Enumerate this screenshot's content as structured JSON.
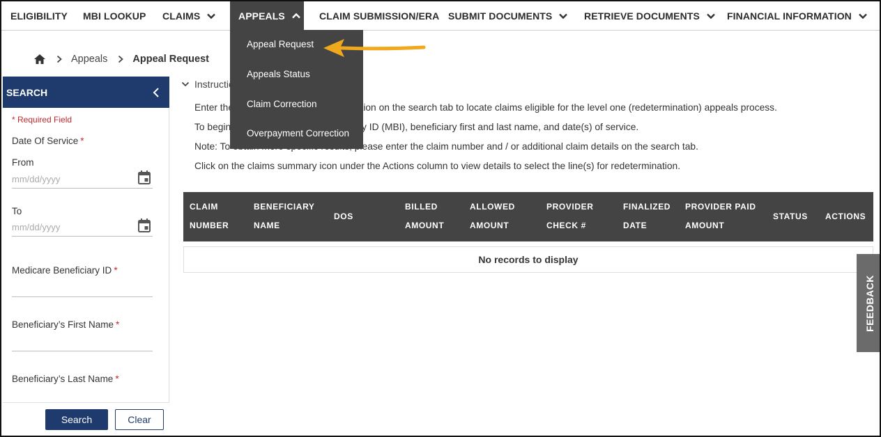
{
  "nav": {
    "items": [
      {
        "label": "ELIGIBILITY",
        "dropdown": false
      },
      {
        "label": "MBI LOOKUP",
        "dropdown": false
      },
      {
        "label": "CLAIMS",
        "dropdown": true
      },
      {
        "label": "APPEALS",
        "dropdown": true,
        "active": true
      },
      {
        "label": "CLAIM SUBMISSION/ERA",
        "dropdown": false
      },
      {
        "label": "SUBMIT DOCUMENTS",
        "dropdown": true
      },
      {
        "label": "RETRIEVE DOCUMENTS",
        "dropdown": true
      },
      {
        "label": "FINANCIAL INFORMATION",
        "dropdown": true
      }
    ],
    "appeals_menu": [
      "Appeal Request",
      "Appeals Status",
      "Claim Correction",
      "Overpayment Correction"
    ]
  },
  "breadcrumb": {
    "icon": "home-icon",
    "parent": "Appeals",
    "current": "Appeal Request"
  },
  "sidebar": {
    "title": "SEARCH",
    "required_note": "* Required Field",
    "date_of_service_label": "Date Of Service",
    "from_label": "From",
    "from_placeholder": "mm/dd/yyyy",
    "to_label": "To",
    "to_placeholder": "mm/dd/yyyy",
    "mbi_label": "Medicare Beneficiary ID",
    "first_name_label": "Beneficiary’s First Name",
    "last_name_label": "Beneficiary’s Last Name",
    "required_marker": "*",
    "search_button": "Search",
    "clear_button": "Clear"
  },
  "instructions": {
    "toggle_label": "Instructions",
    "lines": [
      "Enter the Medicare Beneficiary information on the search tab to locate claims eligible for the level one (redetermination) appeals process.",
      "To begin, enter the Medicare Beneficiary ID (MBI), beneficiary first and last name, and date(s) of service.",
      "Note: To obtain more specific results, please enter the claim number and / or additional claim details on the search tab.",
      "Click on the claims summary icon under the Actions column to view details to select the line(s) for redetermination."
    ]
  },
  "table": {
    "columns": [
      "CLAIM NUMBER",
      "BENEFICIARY NAME",
      "DOS",
      "BILLED AMOUNT",
      "ALLOWED AMOUNT",
      "PROVIDER CHECK #",
      "FINALIZED DATE",
      "PROVIDER PAID AMOUNT",
      "STATUS",
      "ACTIONS"
    ],
    "empty_message": "No records to display"
  },
  "feedback_label": "FEEDBACK",
  "colors": {
    "brand_navy": "#1f3b6e",
    "menu_dark": "#444444",
    "required_red": "#c0282d",
    "annotation_arrow": "#f0a81c"
  }
}
